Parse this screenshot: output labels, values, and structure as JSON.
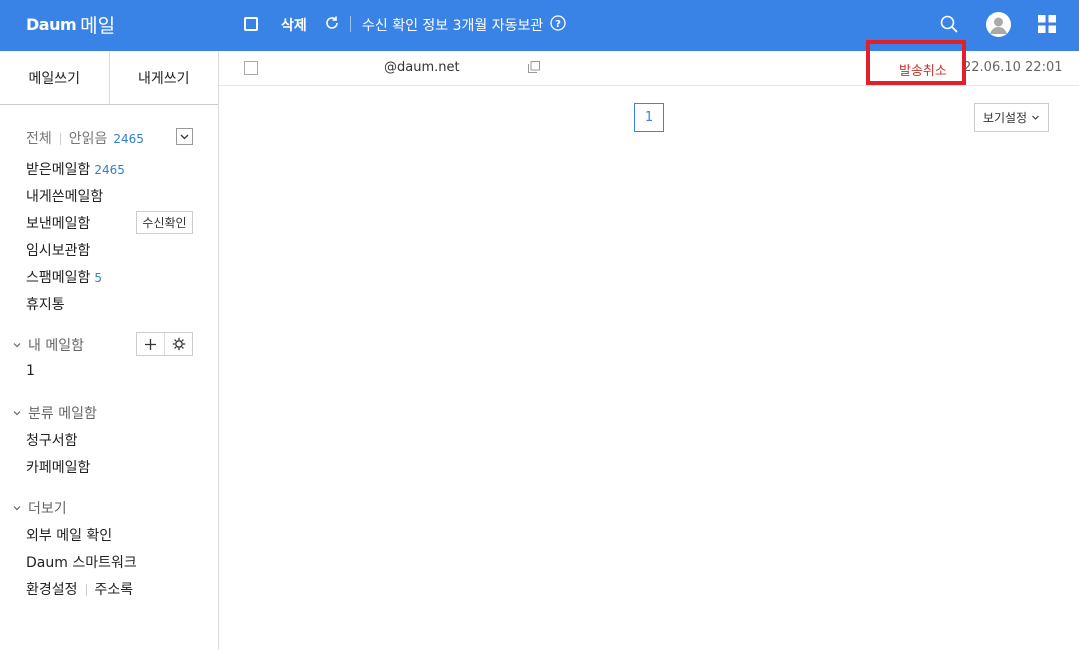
{
  "header": {
    "logo_brand": "Daum",
    "logo_service": "메일",
    "delete_label": "삭제",
    "info_text": "수신 확인 정보 3개월 자동보관"
  },
  "sidebar": {
    "compose_label": "메일쓰기",
    "self_compose_label": "내게쓰기",
    "filter_all": "전체",
    "filter_unread": "안읽음",
    "unread_count": "2465",
    "folders": [
      {
        "label": "받은메일함",
        "count": "2465"
      },
      {
        "label": "내게쓴메일함"
      },
      {
        "label": "보낸메일함",
        "button": "수신확인"
      },
      {
        "label": "임시보관함"
      },
      {
        "label": "스팸메일함",
        "count": "5"
      },
      {
        "label": "휴지통"
      }
    ],
    "my_mailbox": {
      "title": "내 메일함",
      "items": [
        "1"
      ]
    },
    "category_mailbox": {
      "title": "분류 메일함",
      "items": [
        "청구서함",
        "카페메일함"
      ]
    },
    "more": {
      "title": "더보기",
      "items": [
        "외부 메일 확인",
        "Daum 스마트워크"
      ],
      "settings": "환경설정",
      "address_book": "주소록"
    }
  },
  "mail_list": {
    "rows": [
      {
        "sender": "@daum.net",
        "status": "발송취소",
        "date": "22.06.10 22:01"
      }
    ],
    "current_page": "1",
    "view_settings_label": "보기설정"
  },
  "colors": {
    "header_bg": "#3a83e6",
    "accent": "#2f7fd0",
    "status_red": "#c8342e",
    "highlight_box": "#e0202a"
  }
}
